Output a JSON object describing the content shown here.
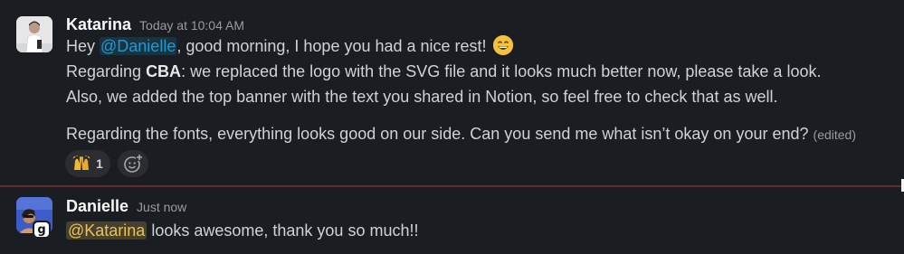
{
  "messages": [
    {
      "author": "Katarina",
      "time": "Today at 10:04 AM",
      "line1": {
        "pre": "Hey ",
        "mention": "@Danielle",
        "post": ", good morning, I hope you had a nice rest!",
        "emoji": "grinning-face-icon"
      },
      "line2": {
        "pre": "Regarding ",
        "bold": "CBA",
        "post": ": we replaced the logo with the SVG file and it looks much better now, please take a look."
      },
      "line3": "Also, we added the top banner with the text you shared in Notion, so feel free to check that as well.",
      "line4": "Regarding the fonts, everything looks good on our side. Can you send me what isn’t okay on your end?",
      "edited": "(edited)",
      "reactions": [
        {
          "emoji": "raised-hands-icon",
          "count": "1"
        }
      ]
    },
    {
      "author": "Danielle",
      "time": "Just now",
      "mention": "@Katarina",
      "text": " looks awesome, thank you so much!!",
      "badge": "g"
    }
  ],
  "colors": {
    "background": "#1a1d21",
    "mention_blue": "#1d9bd1",
    "mention_gold": "#e8c15a",
    "divider": "#6b2a2a"
  }
}
